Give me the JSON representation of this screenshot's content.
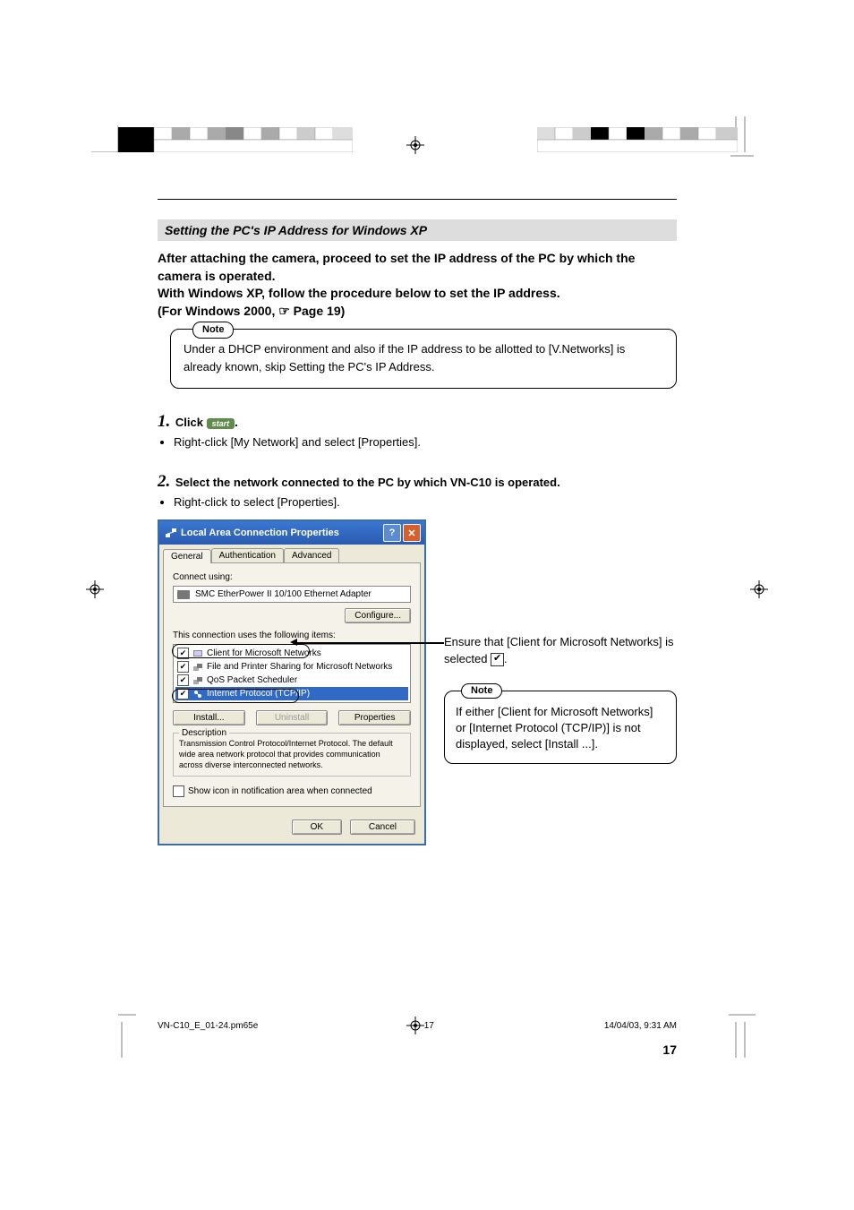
{
  "section_title": "Setting the PC's IP Address for Windows XP",
  "intro_p1": "After attaching the camera, proceed to set the IP address of the PC by which the camera is operated.",
  "intro_p2": "With Windows XP, follow the procedure below to set the IP address.",
  "intro_p3_a": "(For Windows 2000, ",
  "intro_p3_b": " Page 19)",
  "note_label": "Note",
  "note1_text": "Under a DHCP environment and also if the IP address to be allotted to [V.Networks] is already known, skip Setting the PC's IP Address.",
  "step1": {
    "num": "1.",
    "head_a": "Click ",
    "start_btn": "start",
    "head_b": ".",
    "bullet": "Right-click [My Network] and select [Properties]."
  },
  "step2": {
    "num": "2.",
    "head": "Select the network connected to the PC by which VN-C10 is operated.",
    "bullet": "Right-click to select [Properties]."
  },
  "dialog": {
    "title": "Local Area Connection Properties",
    "tabs": [
      "General",
      "Authentication",
      "Advanced"
    ],
    "connect_using": "Connect using:",
    "adapter": "SMC EtherPower II 10/100 Ethernet Adapter",
    "configure": "Configure...",
    "uses_items": "This connection uses the following items:",
    "items": [
      {
        "label": "Client for Microsoft Networks",
        "checked": true,
        "selected": false
      },
      {
        "label": "File and Printer Sharing for Microsoft Networks",
        "checked": true,
        "selected": false
      },
      {
        "label": "QoS Packet Scheduler",
        "checked": true,
        "selected": false
      },
      {
        "label": "Internet Protocol (TCP/IP)",
        "checked": true,
        "selected": true
      }
    ],
    "install": "Install...",
    "uninstall": "Uninstall",
    "properties": "Properties",
    "desc_legend": "Description",
    "desc_text": "Transmission Control Protocol/Internet Protocol. The default wide area network protocol that provides communication across diverse interconnected networks.",
    "show_icon": "Show icon in notification area when connected",
    "ok": "OK",
    "cancel": "Cancel"
  },
  "side_text_a": "Ensure that [Client for Microsoft Networks] is selected ",
  "side_text_b": ".",
  "note2_text": "If either [Client for Microsoft Networks] or [Internet Protocol (TCP/IP)] is not displayed, select [Install ...].",
  "page_number": "17",
  "footer": {
    "filename": "VN-C10_E_01-24.pm65e",
    "page": "17",
    "datetime": "14/04/03, 9:31 AM"
  }
}
